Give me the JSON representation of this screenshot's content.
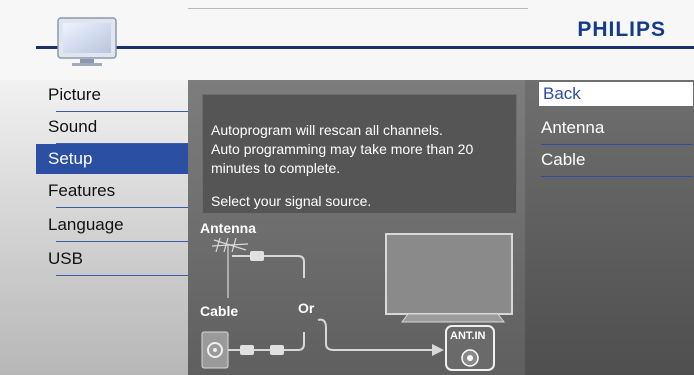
{
  "header": {
    "brand": "PHILIPS",
    "icon": "tv-icon"
  },
  "left_menu": {
    "items": [
      {
        "label": "Picture",
        "selected": false
      },
      {
        "label": "Sound",
        "selected": false
      },
      {
        "label": "Setup",
        "selected": true
      },
      {
        "label": "Features",
        "selected": false
      },
      {
        "label": "Language",
        "selected": false
      },
      {
        "label": "USB",
        "selected": false
      }
    ]
  },
  "center": {
    "message_lines": [
      "Autoprogram will rescan all channels.",
      "Auto programming  may take more than 20",
      "minutes to complete."
    ],
    "prompt": "Select your signal source.",
    "diagram": {
      "antenna_label": "Antenna",
      "cable_label": "Cable",
      "or_label": "Or",
      "ant_in_label": "ANT.IN"
    }
  },
  "right_menu": {
    "items": [
      {
        "label": "Back",
        "highlighted": true
      },
      {
        "label": "Antenna",
        "highlighted": false
      },
      {
        "label": "Cable",
        "highlighted": false
      }
    ]
  },
  "colors": {
    "brand": "#143a8c",
    "selected_bg": "#2b4fa2"
  }
}
